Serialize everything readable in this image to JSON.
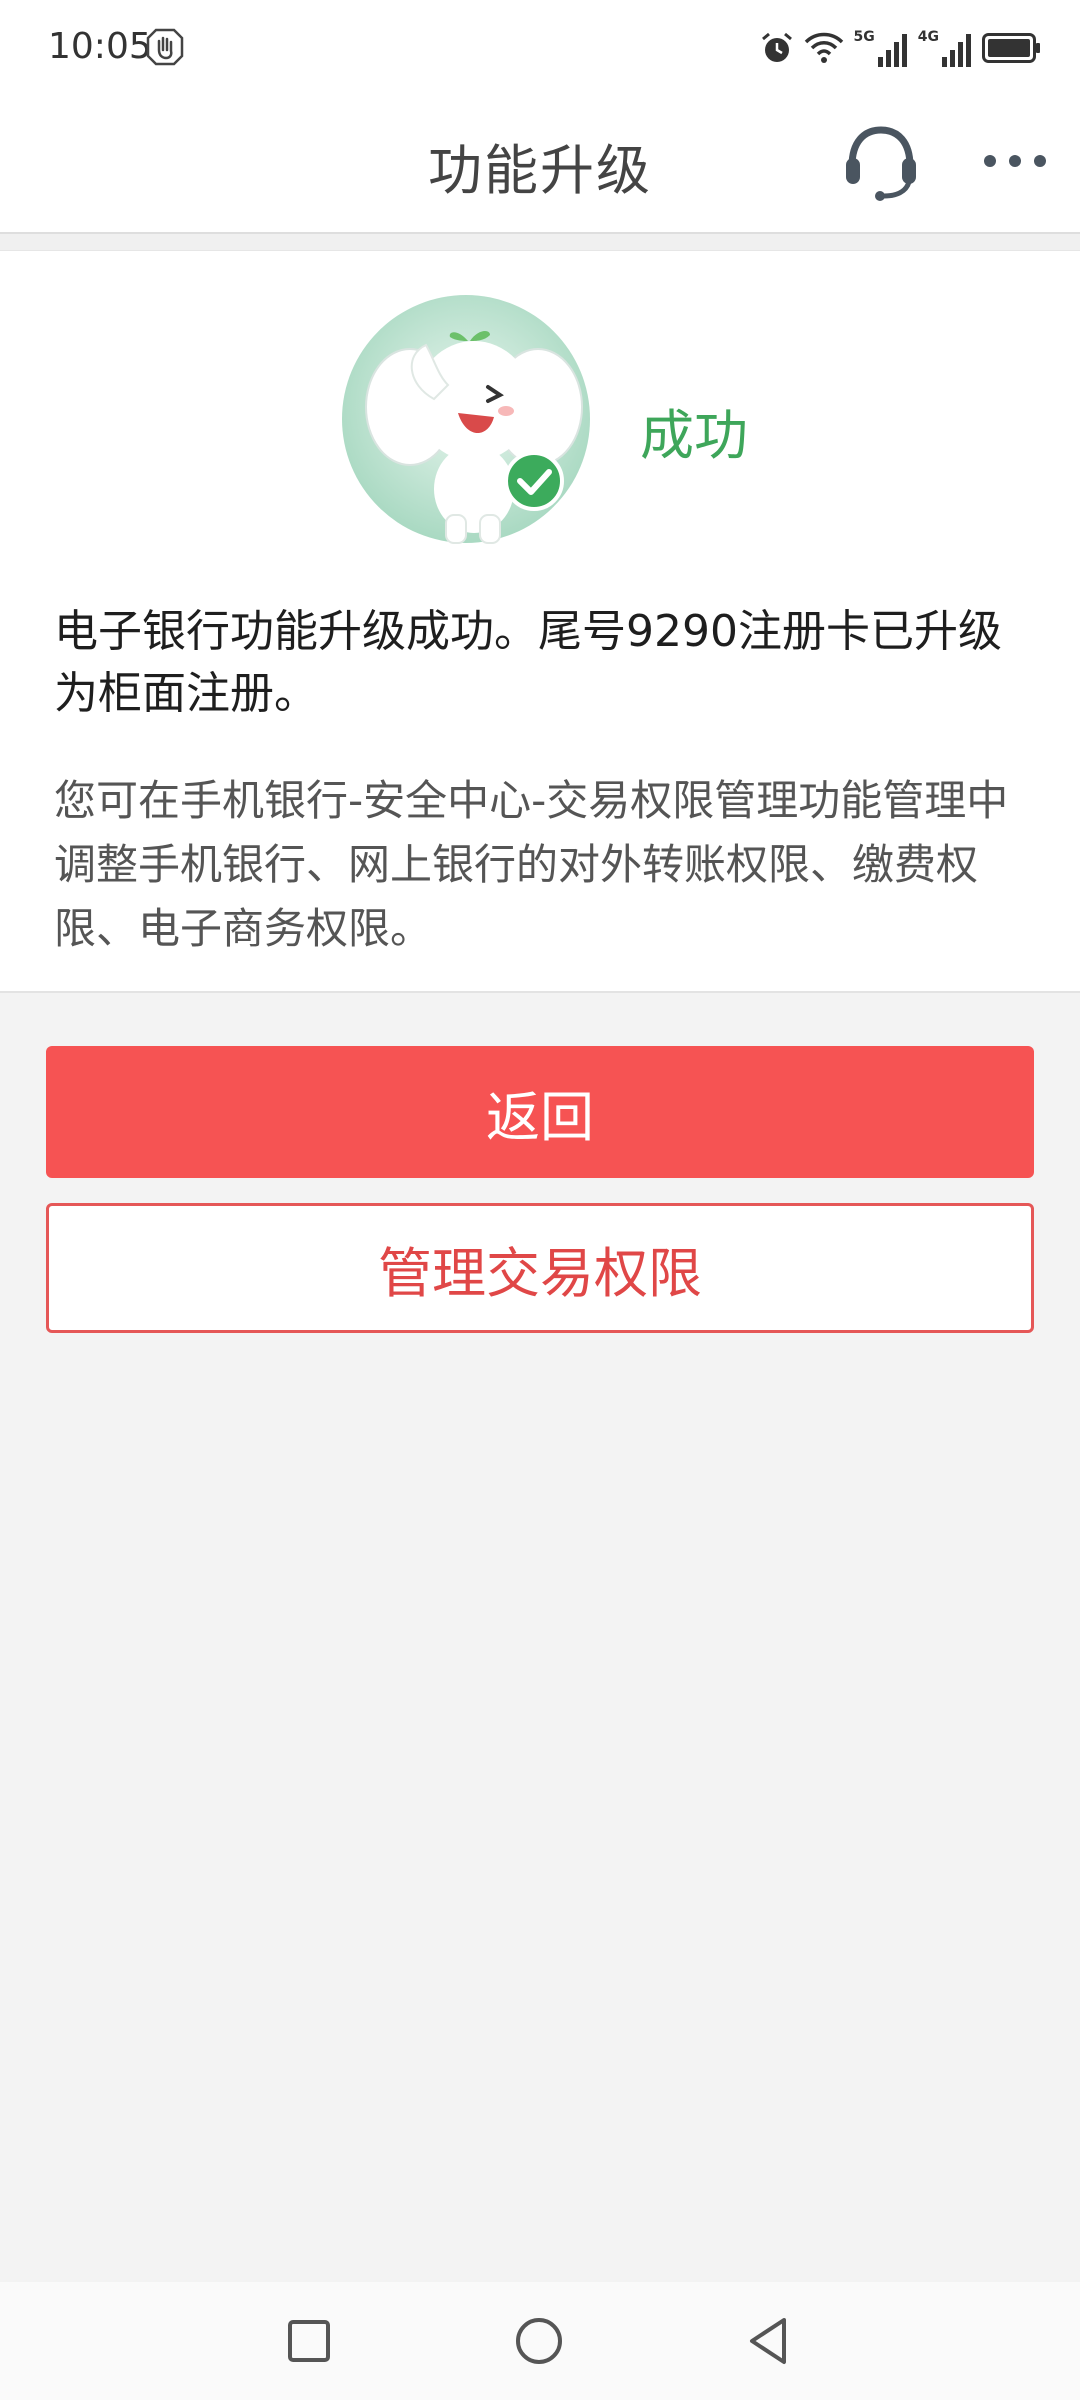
{
  "status_bar": {
    "time": "10:05",
    "signal_1_label": "5G",
    "signal_2_label": "4G"
  },
  "header": {
    "title": "功能升级",
    "icons": [
      "headset-icon",
      "more-icon"
    ]
  },
  "result": {
    "status_text": "成功",
    "status_color": "#3ea65a",
    "main_message": "电子银行功能升级成功。尾号9290注册卡已升级为柜面注册。",
    "sub_message": "您可在手机银行-安全中心-交易权限管理功能管理中调整手机银行、网上银行的对外转账权限、缴费权限、电子商务权限。"
  },
  "actions": {
    "back_label": "返回",
    "manage_label": "管理交易权限",
    "accent_color": "#f65353"
  },
  "nav_bar": {
    "icons": [
      "recent-apps-icon",
      "home-icon",
      "back-icon"
    ]
  }
}
